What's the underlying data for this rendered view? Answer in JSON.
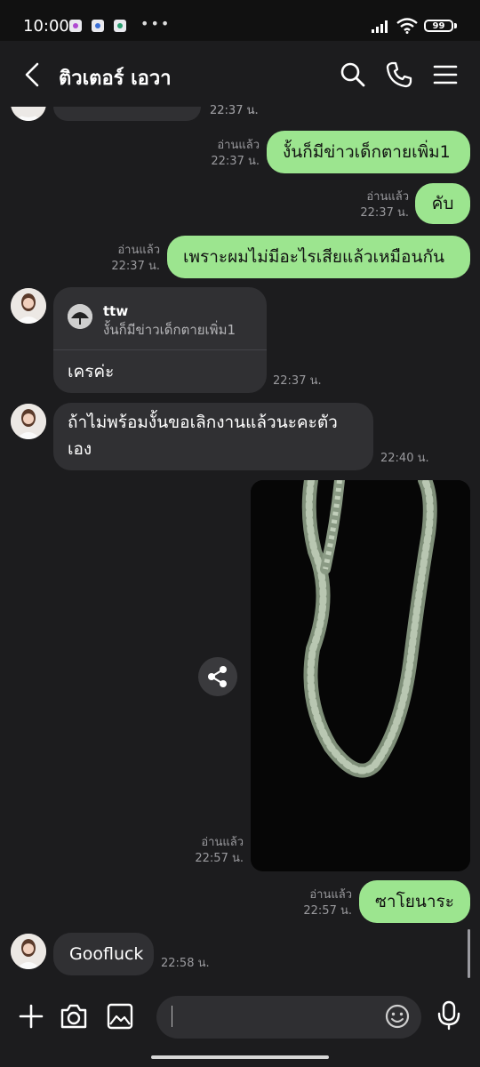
{
  "status_bar": {
    "time": "10:00",
    "more": "•••",
    "battery": "99",
    "icons": [
      "notification-app-icon",
      "notification-app-icon",
      "notification-app-icon",
      "signal-icon",
      "wifi-icon",
      "battery-icon"
    ]
  },
  "header": {
    "back_icon": "chevron-left-icon",
    "title": "ติวเตอร์ เอวา",
    "actions": [
      "search-icon",
      "phone-icon",
      "menu-icon"
    ]
  },
  "messages": {
    "top_partial_time": "22:37 น.",
    "m1": {
      "text": "งั้นก็มีข่าวเด็กตายเพิ่ม1",
      "read": "อ่านแล้ว",
      "time": "22:37 น."
    },
    "m2": {
      "text": "คับ",
      "read": "อ่านแล้ว",
      "time": "22:37 น."
    },
    "m3": {
      "text": "เพราะผมไม่มีอะไรเสียแล้วเหมือนกัน",
      "read": "อ่านแล้ว",
      "time": "22:37 น."
    },
    "reply": {
      "quoted_user": "ttw",
      "quoted_text": "งั้นก็มีข่าวเด็กตายเพิ่ม1",
      "text": "เครค่ะ",
      "time": "22:37 น."
    },
    "m5": {
      "line1": "ถ้าไม่พร้อมงั้นขอเลิกงานแล้วนะคะตัว",
      "line2": "เอง",
      "time": "22:40 น."
    },
    "photo": {
      "read": "อ่านแล้ว",
      "time": "22:57 น.",
      "share_icon": "share-icon"
    },
    "m7": {
      "text": "ซาโยนาระ",
      "read": "อ่านแล้ว",
      "time": "22:57 น."
    },
    "m8": {
      "text": "Goofluck",
      "time": "22:58 น."
    }
  },
  "input_bar": {
    "icons": [
      "plus-icon",
      "camera-icon",
      "image-icon",
      "emoji-icon",
      "microphone-icon"
    ],
    "value": ""
  },
  "colors": {
    "outgoing_bubble": "#9ce58f",
    "incoming_bubble": "#303033",
    "background": "#1c1c1e"
  }
}
